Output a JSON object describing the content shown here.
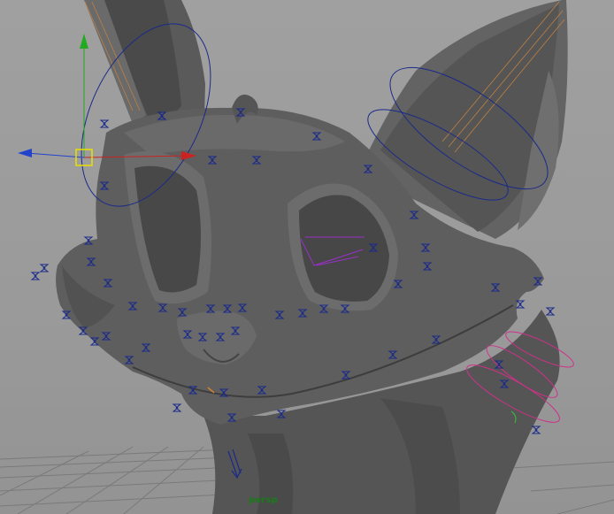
{
  "viewport": {
    "camera_label": "persp",
    "background_color": "#9c9c9c"
  },
  "model": {
    "name": "fox-character-head",
    "mesh_color": "#5c5c5c",
    "shadow_color": "#3a3a3a",
    "highlight_color": "#6e6e6e"
  },
  "rig": {
    "control_color": "#1a2a8a",
    "eyelid_control_color": "#9a30c8",
    "fur_control_color": "#d0308a",
    "ear_joint_color": "#c08040"
  },
  "manipulator": {
    "x_axis_color": "#cc2222",
    "y_axis_color": "#22aa22",
    "z_axis_color": "#2244cc",
    "center_color": "#e8e000"
  }
}
